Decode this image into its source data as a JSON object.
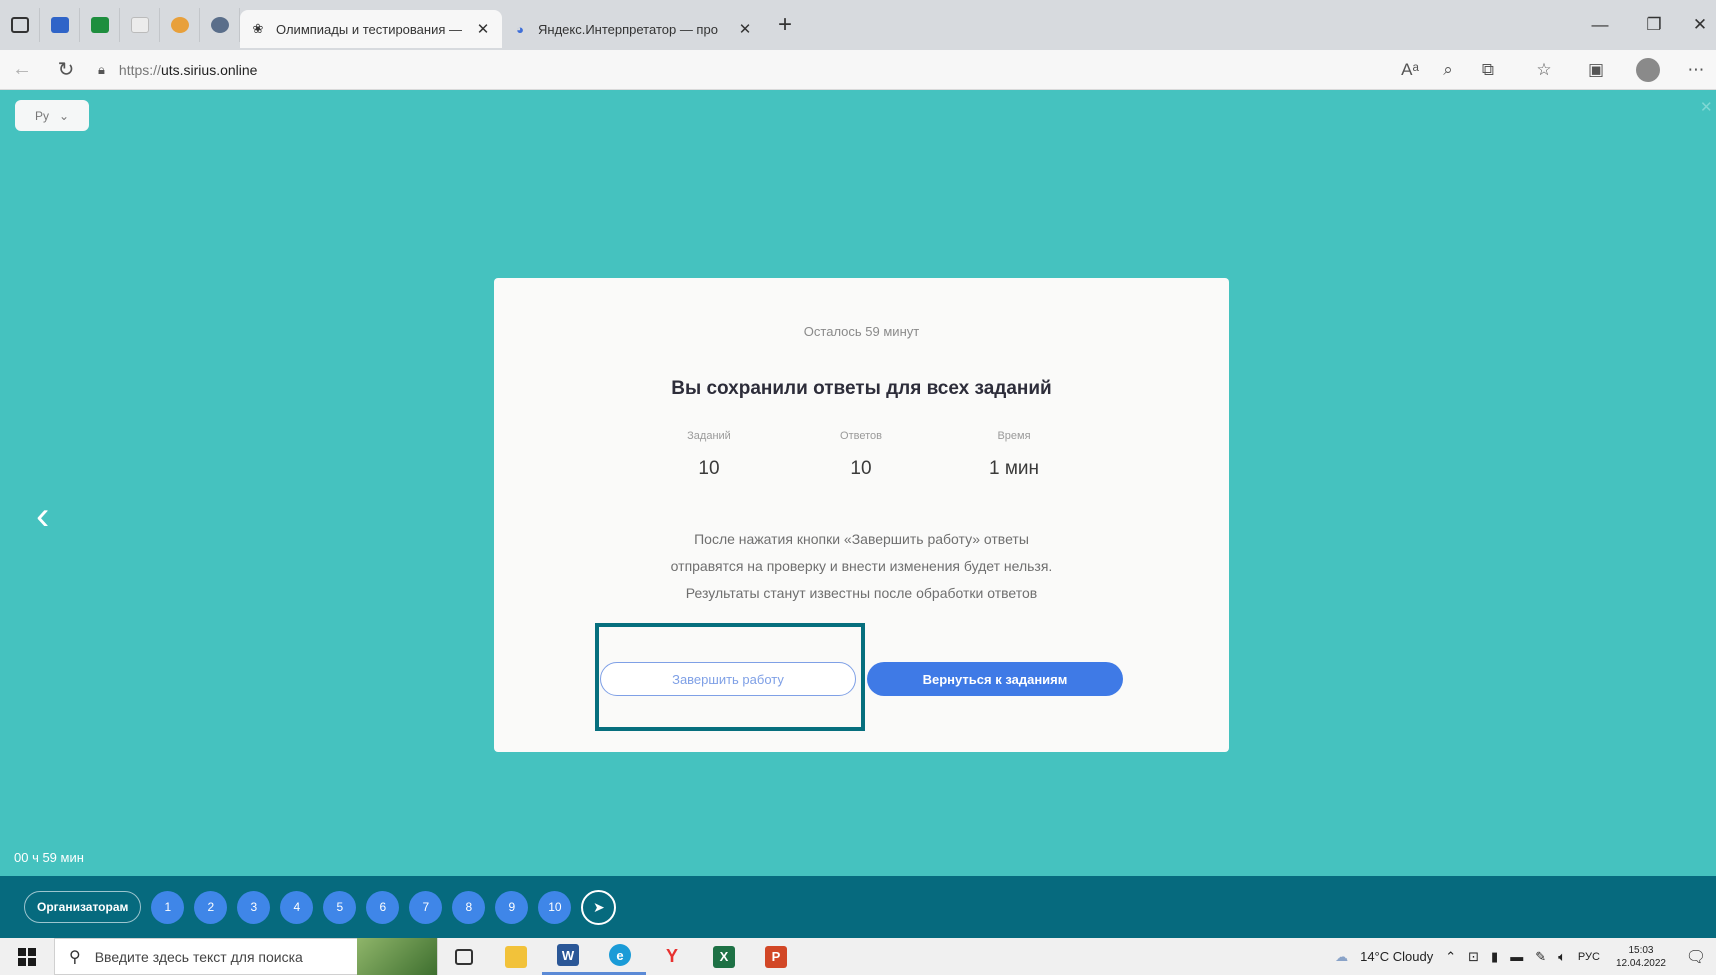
{
  "browser": {
    "tabs": [
      {
        "title": "Олимпиады и тестирования —",
        "active": true
      },
      {
        "title": "Яндекс.Интерпретатор — про",
        "active": false
      }
    ],
    "url_protocol": "https://",
    "url_host": "uts.sirius.online"
  },
  "page": {
    "language": "Ру",
    "remaining": "Осталось 59 минут",
    "heading": "Вы сохранили ответы для всех заданий",
    "stats": [
      {
        "label": "Заданий",
        "value": "10"
      },
      {
        "label": "Ответов",
        "value": "10"
      },
      {
        "label": "Время",
        "value": "1 мин"
      }
    ],
    "notice": [
      "После нажатия кнопки «Завершить работу» ответы",
      "отправятся на проверку и внести изменения будет нельзя.",
      "Результаты станут известны после обработки ответов"
    ],
    "finish_button": "Завершить работу",
    "return_button": "Вернуться к заданиям",
    "timer": "00 ч 59 мин"
  },
  "task_nav": {
    "organizers_label": "Организаторам",
    "tasks": [
      "1",
      "2",
      "3",
      "4",
      "5",
      "6",
      "7",
      "8",
      "9",
      "10"
    ]
  },
  "windows_taskbar": {
    "search_placeholder": "Введите здесь текст для поиска",
    "weather": "14°C Cloudy",
    "language": "РУС",
    "time": "15:03",
    "date": "12.04.2022"
  },
  "colors": {
    "page_background": "#45c2bf",
    "primary_button": "#3f7ae6",
    "task_bar": "#066a7e",
    "highlight_frame": "#066f7e"
  }
}
